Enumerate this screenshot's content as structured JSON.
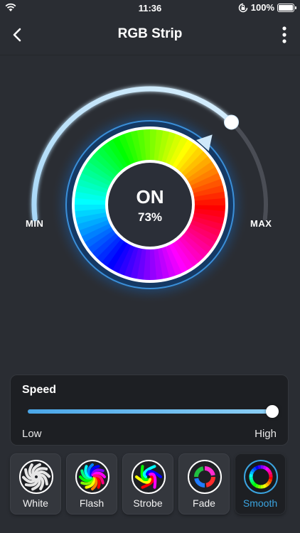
{
  "status": {
    "time": "11:36",
    "battery": "100%"
  },
  "nav": {
    "title": "RGB Strip",
    "back_icon": "chevron-left-icon",
    "more_icon": "more-vertical-icon"
  },
  "dial": {
    "state": "ON",
    "brightness_label": "73%",
    "brightness": 0.73,
    "min_label": "MIN",
    "max_label": "MAX",
    "accent": "#4aa6e8"
  },
  "speed": {
    "title": "Speed",
    "low_label": "Low",
    "high_label": "High",
    "value": 1.0
  },
  "modes": [
    {
      "label": "White",
      "icon": "spiral-white-icon",
      "active": false
    },
    {
      "label": "Flash",
      "icon": "rainbow-spiral-icon",
      "active": false
    },
    {
      "label": "Strobe",
      "icon": "rainbow-swirl-icon",
      "active": false
    },
    {
      "label": "Fade",
      "icon": "rainbow-ring-icon",
      "active": false
    },
    {
      "label": "Smooth",
      "icon": "rainbow-smooth-icon",
      "active": true
    }
  ],
  "colors": {
    "background": "#2a2d33",
    "panel": "#1d1f23",
    "active_text": "#3ba4e0"
  }
}
